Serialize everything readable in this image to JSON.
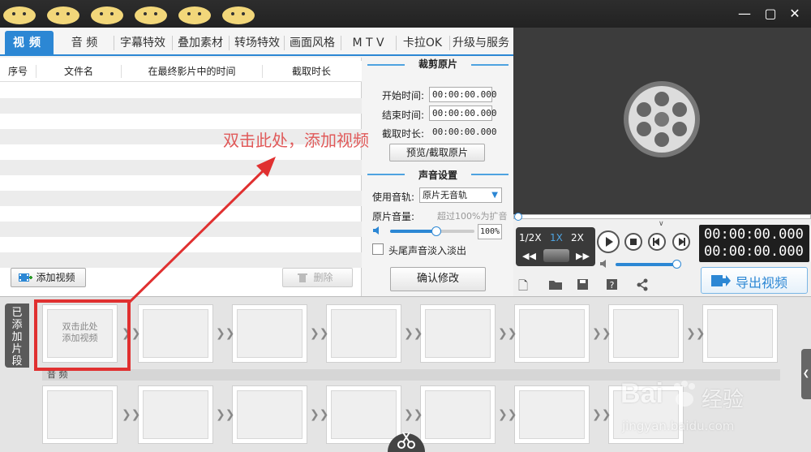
{
  "tabs": [
    "视频",
    "音 频",
    "字幕特效",
    "叠加素材",
    "转场特效",
    "画面风格",
    "M T V",
    "卡拉OK",
    "升级与服务"
  ],
  "window_controls": [
    "minimize",
    "maximize",
    "close"
  ],
  "list": {
    "columns": [
      "序号",
      "文件名",
      "在最终影片中的时间",
      "截取时长"
    ],
    "hint": "双击此处，添加视频",
    "add_video": "添加视频",
    "delete": "删除"
  },
  "crop": {
    "title": "裁剪原片",
    "start_label": "开始时间:",
    "start_value": "00:00:00.000",
    "end_label": "结束时间:",
    "end_value": "00:00:00.000",
    "dur_label": "截取时长:",
    "dur_value": "00:00:00.000",
    "preview_btn": "预览/截取原片"
  },
  "audio": {
    "title": "声音设置",
    "track_label": "使用音轨:",
    "track_value": "原片无音轨",
    "volume_label": "原片音量:",
    "volume_hint": "超过100%为扩音",
    "volume_value": "100%",
    "volume_level": 0.55,
    "fade_label": "头尾声音淡入淡出",
    "confirm_btn": "确认修改"
  },
  "player": {
    "speeds": [
      "1/2X",
      "1X",
      "2X"
    ],
    "time_current": "00:00:00.000",
    "time_total": "00:00:00.000",
    "export": "导出视频"
  },
  "timeline": {
    "added_tab": "已添加片段",
    "first_slot": "双击此处\n添加视频",
    "audio_label": "音 频"
  },
  "watermark": {
    "brand": "Bai",
    "brand_cn": "经验",
    "url": "jingyan.baidu.com"
  },
  "colors": {
    "accent": "#2c87d4",
    "annotation": "#e03030"
  }
}
